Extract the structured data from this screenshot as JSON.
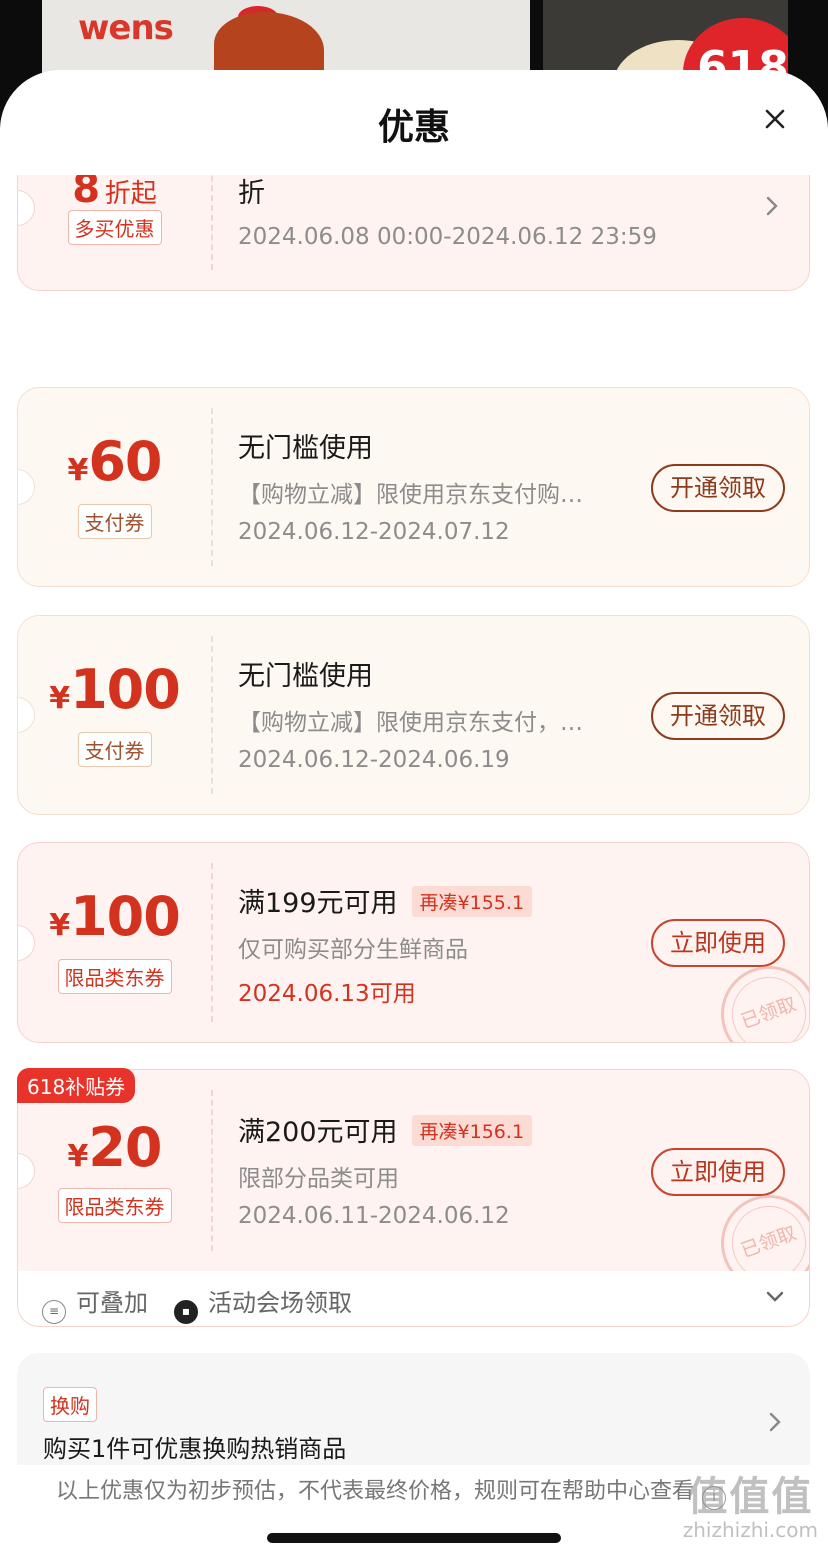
{
  "backdrop": {
    "brand_logo": "wens",
    "promo_badge": "618"
  },
  "sheet": {
    "title": "优惠"
  },
  "coupons": [
    {
      "type": "discount",
      "amount_suffix": "折起",
      "tag": "多买优惠",
      "line1": "折",
      "line3": "2024.06.08 00:00-2024.06.12 23:59"
    },
    {
      "type": "pay",
      "currency": "¥",
      "amount": "60",
      "tag": "支付券",
      "line1": "无门槛使用",
      "line2": "【购物立减】限使用京东支付购…",
      "line3": "2024.06.12-2024.07.12",
      "action": "开通领取"
    },
    {
      "type": "pay",
      "currency": "¥",
      "amount": "100",
      "tag": "支付券",
      "line1": "无门槛使用",
      "line2": "【购物立减】限使用京东支付，…",
      "line3": "2024.06.12-2024.06.19",
      "action": "开通领取"
    },
    {
      "type": "jd",
      "currency": "¥",
      "amount": "100",
      "tag": "限品类东券",
      "line1": "满199元可用",
      "extra": "再凑¥155.1",
      "line2": "仅可购买部分生鲜商品",
      "line3": "2024.06.13可用",
      "action": "立即使用",
      "stamp": "已领取"
    },
    {
      "type": "jd",
      "corner_badge": "618补贴券",
      "currency": "¥",
      "amount": "20",
      "tag": "限品类东券",
      "line1": "满200元可用",
      "extra": "再凑¥156.1",
      "line2": "限部分品类可用",
      "line3": "2024.06.11-2024.06.12",
      "action": "立即使用",
      "stamp": "已领取"
    }
  ],
  "meta": {
    "stackable": "可叠加",
    "venue": "活动会场领取"
  },
  "swap": {
    "tag": "换购",
    "text": "购买1件可优惠换购热销商品"
  },
  "footer": {
    "note": "以上优惠仅为初步预估，不代表最终价格，规则可在帮助中心查看"
  },
  "watermark": {
    "big": "值值值",
    "small": "zhizhizhi.com"
  },
  "colors": {
    "accent_red": "#d3321f",
    "pay_brown": "#8c3b1c",
    "badge_red": "#e8332a"
  }
}
